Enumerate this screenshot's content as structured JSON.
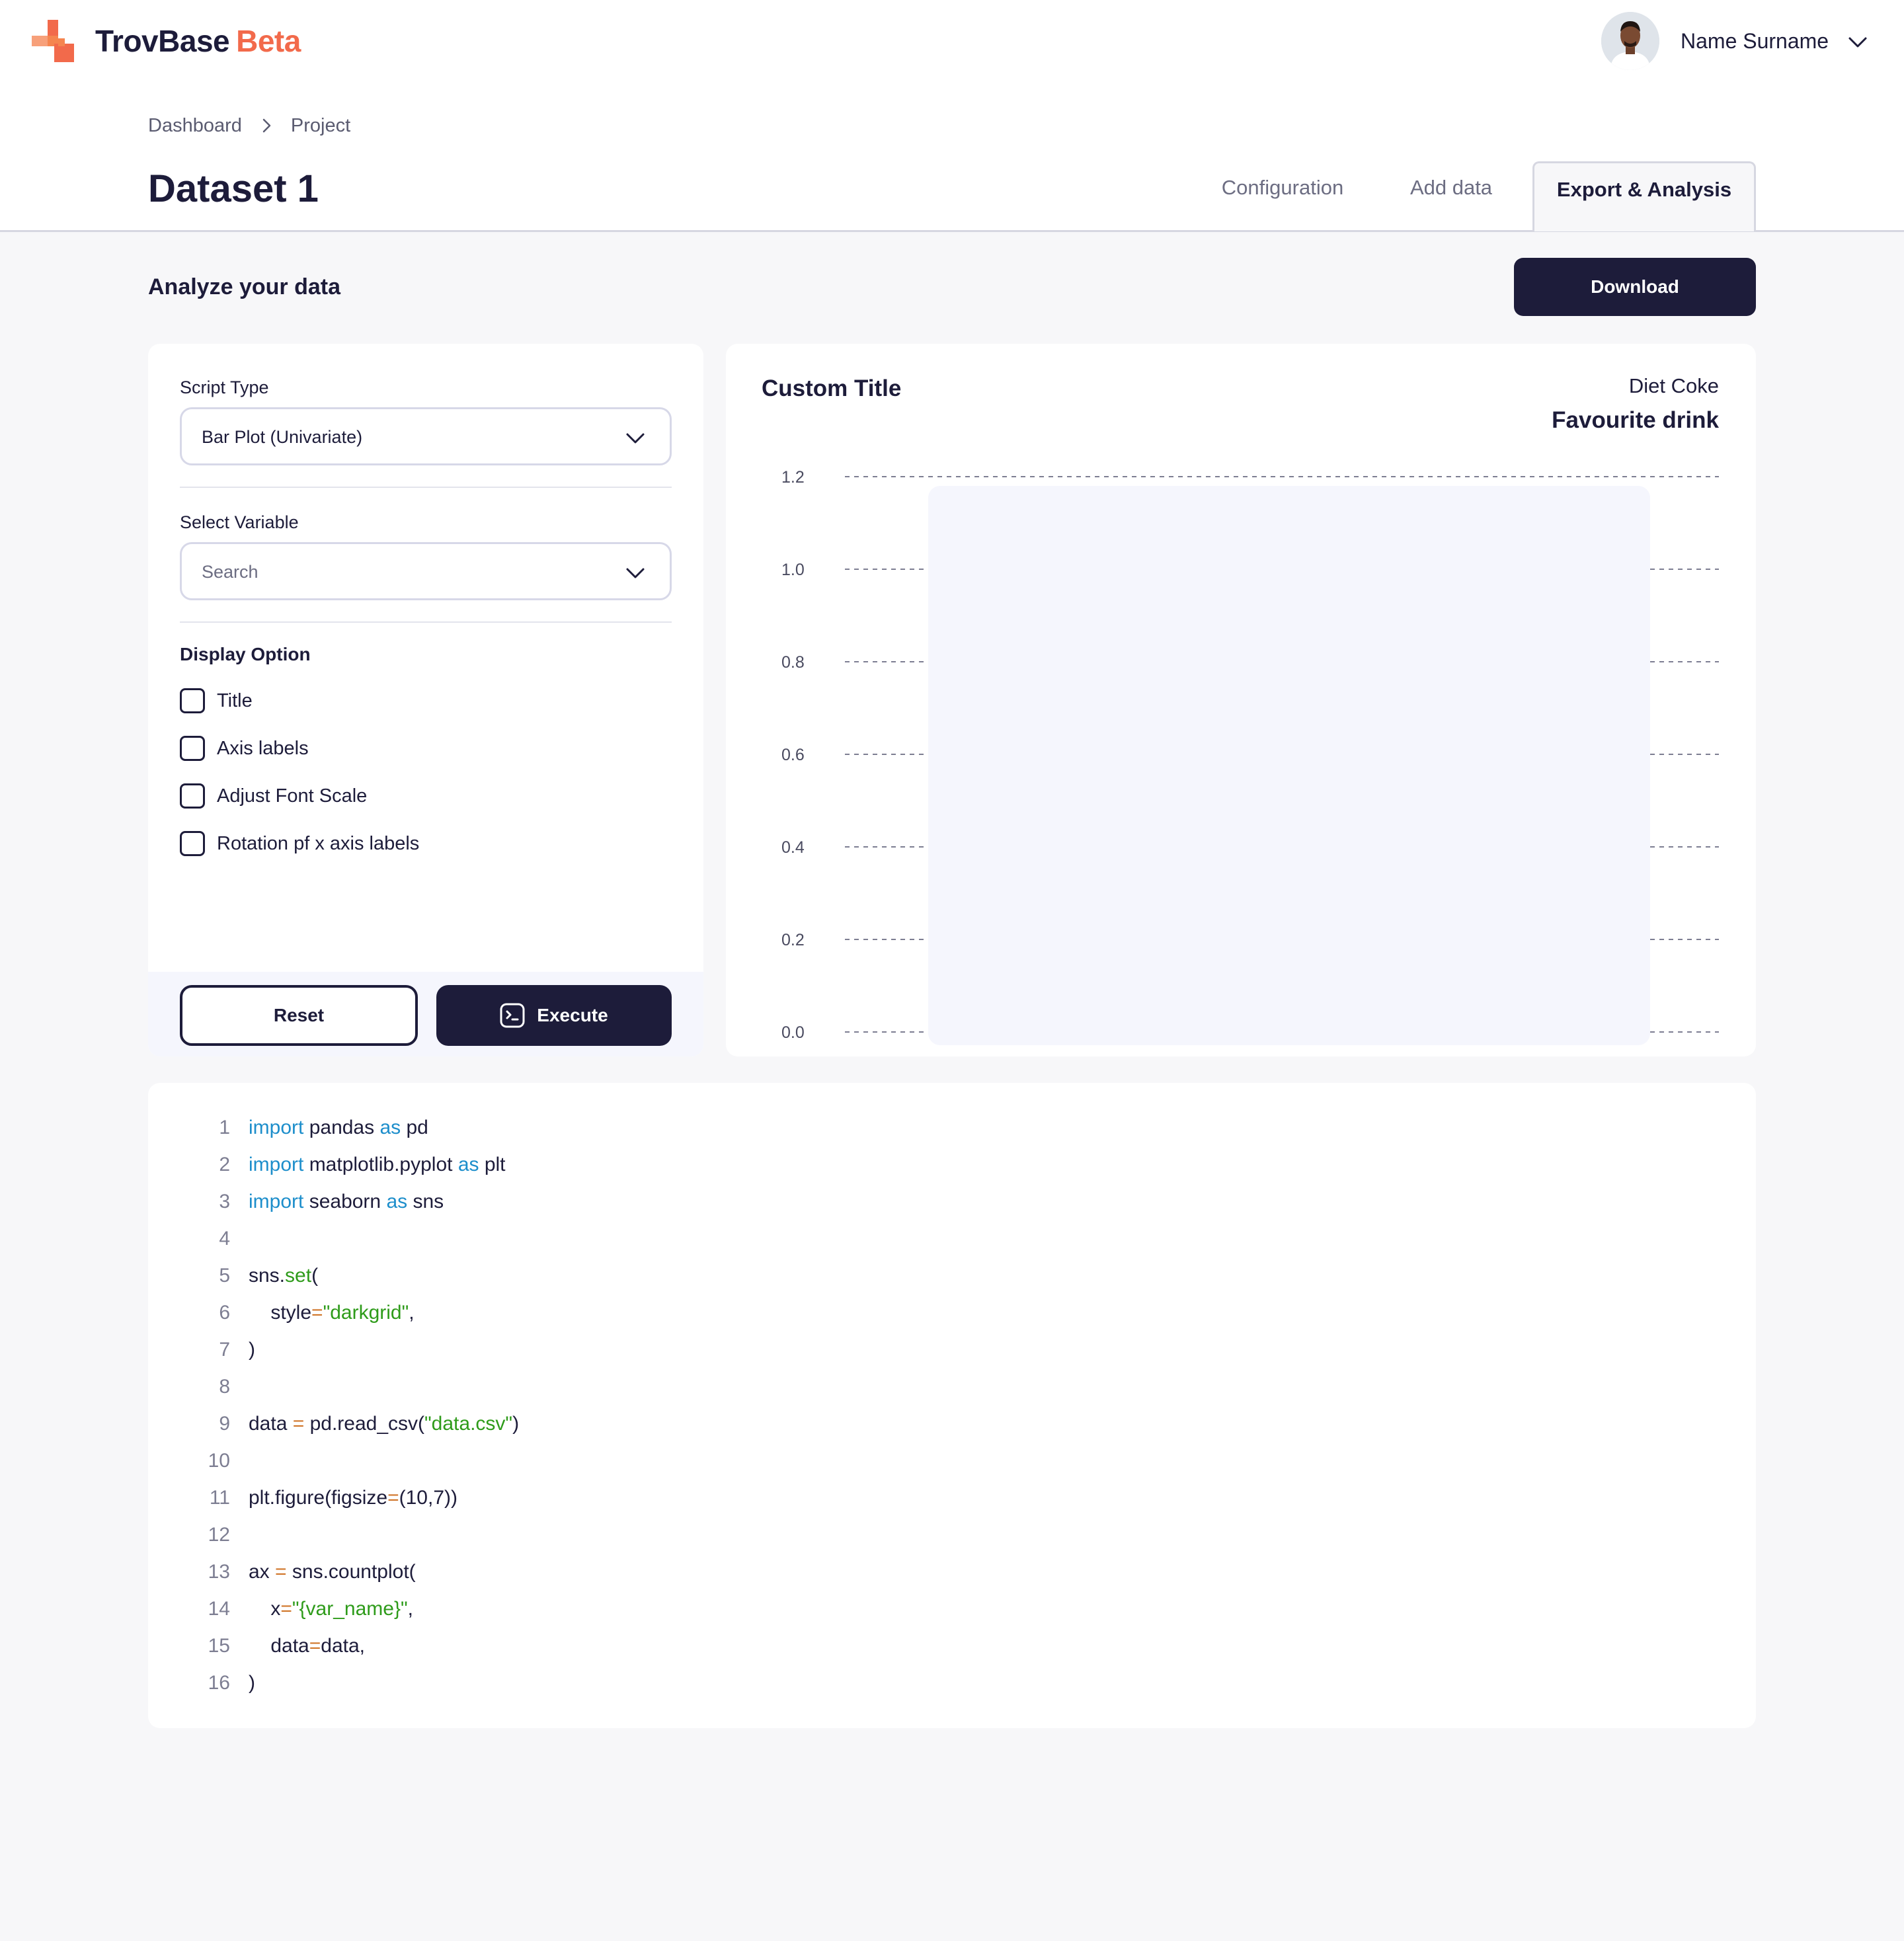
{
  "app": {
    "name": "TrovBase",
    "badge": "Beta",
    "accent": "#f26a4b",
    "dark": "#1d1c3a"
  },
  "user": {
    "name": "Name Surname"
  },
  "breadcrumb": [
    {
      "label": "Dashboard"
    },
    {
      "label": "Project"
    }
  ],
  "page": {
    "title": "Dataset 1"
  },
  "tabs": [
    {
      "label": "Configuration",
      "active": false
    },
    {
      "label": "Add data",
      "active": false
    },
    {
      "label": "Export & Analysis",
      "active": true
    }
  ],
  "analyze": {
    "title": "Analyze your data",
    "download_label": "Download",
    "script_type": {
      "label": "Script Type",
      "value": "Bar Plot (Univariate)"
    },
    "variable": {
      "label": "Select Variable",
      "placeholder": "Search"
    },
    "display_option": {
      "title": "Display Option",
      "options": [
        {
          "label": "Title",
          "checked": false
        },
        {
          "label": "Axis labels",
          "checked": false
        },
        {
          "label": "Adjust Font Scale",
          "checked": false
        },
        {
          "label": "Rotation pf x axis labels",
          "checked": false
        }
      ]
    },
    "reset_label": "Reset",
    "execute_label": "Execute"
  },
  "chart_data": {
    "type": "bar",
    "title": "Custom Title",
    "legend": {
      "title": "Favourite drink",
      "entries": [
        "Diet Coke"
      ],
      "placement": "top-right"
    },
    "categories": [
      "Diet Coke"
    ],
    "values": [
      1.2
    ],
    "bar_color": "#f5f6fd",
    "yticks": [
      "0.0",
      "0.2",
      "0.4",
      "0.6",
      "0.8",
      "1.0",
      "1.2"
    ],
    "ylim": [
      0,
      1.2
    ],
    "grid": true,
    "xlabel": "",
    "ylabel": ""
  },
  "code": [
    [
      [
        "kw",
        "import"
      ],
      [
        "t",
        " pandas "
      ],
      [
        "kw",
        "as"
      ],
      [
        "t",
        " pd"
      ]
    ],
    [
      [
        "kw",
        "import"
      ],
      [
        "t",
        " matplotlib.pyplot "
      ],
      [
        "kw",
        "as"
      ],
      [
        "t",
        " plt"
      ]
    ],
    [
      [
        "kw",
        "import"
      ],
      [
        "t",
        " seaborn "
      ],
      [
        "kw",
        "as"
      ],
      [
        "t",
        " sns"
      ]
    ],
    [],
    [
      [
        "t",
        "sns."
      ],
      [
        "fn",
        "set"
      ],
      [
        "t",
        "("
      ]
    ],
    [
      [
        "t",
        "    style"
      ],
      [
        "op",
        "="
      ],
      [
        "str",
        "\"darkgrid\""
      ],
      [
        "t",
        ","
      ]
    ],
    [
      [
        "t",
        ")"
      ]
    ],
    [],
    [
      [
        "t",
        "data "
      ],
      [
        "op",
        "="
      ],
      [
        "t",
        " pd.read_csv("
      ],
      [
        "str",
        "\"data.csv\""
      ],
      [
        "t",
        ")"
      ]
    ],
    [],
    [
      [
        "t",
        "plt.figure(figsize"
      ],
      [
        "op",
        "="
      ],
      [
        "t",
        "(10,7))"
      ]
    ],
    [],
    [
      [
        "t",
        "ax "
      ],
      [
        "op",
        "="
      ],
      [
        "t",
        " sns.countplot("
      ]
    ],
    [
      [
        "t",
        "    x"
      ],
      [
        "op",
        "="
      ],
      [
        "str",
        "\"{var_name}\""
      ],
      [
        "t",
        ","
      ]
    ],
    [
      [
        "t",
        "    data"
      ],
      [
        "op",
        "="
      ],
      [
        "t",
        "data,"
      ]
    ],
    [
      [
        "t",
        ")"
      ]
    ]
  ]
}
